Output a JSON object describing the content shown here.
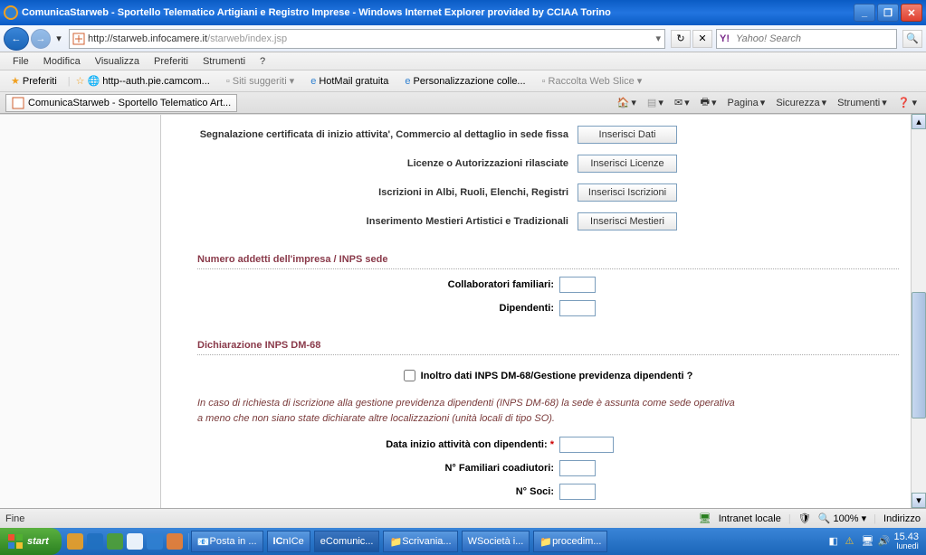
{
  "window": {
    "title": "ComunicaStarweb - Sportello Telematico Artigiani e Registro Imprese - Windows Internet Explorer provided by CCIAA Torino"
  },
  "address": {
    "host": "http://starweb.infocamere.it",
    "path": "/starweb/index.jsp"
  },
  "search": {
    "placeholder": "Yahoo! Search"
  },
  "menu": {
    "file": "File",
    "modifica": "Modifica",
    "visualizza": "Visualizza",
    "preferiti": "Preferiti",
    "strumenti": "Strumenti",
    "help": "?"
  },
  "favbar": {
    "preferiti": "Preferiti",
    "links": [
      "http--auth.pie.camcom...",
      "Siti suggeriti",
      "HotMail gratuita",
      "Personalizzazione colle...",
      "Raccolta Web Slice"
    ]
  },
  "tab": {
    "title": "ComunicaStarweb - Sportello Telematico Art..."
  },
  "cmdbar": {
    "pagina": "Pagina",
    "sicurezza": "Sicurezza",
    "strumenti": "Strumenti"
  },
  "form": {
    "rows": [
      {
        "label": "Segnalazione certificata di inizio attivita",
        "suffix": ", Commercio al dettaglio in sede fissa",
        "button": "Inserisci Dati"
      },
      {
        "label": "Licenze o Autorizzazioni rilasciate",
        "button": "Inserisci Licenze"
      },
      {
        "label": "Iscrizioni in Albi, Ruoli, Elenchi, Registri",
        "button": "Inserisci Iscrizioni"
      },
      {
        "label": "Inserimento Mestieri Artistici e Tradizionali",
        "button": "Inserisci Mestieri"
      }
    ],
    "section_addetti": "Numero addetti dell'impresa / INPS sede",
    "collab_label": "Collaboratori familiari:",
    "dipend_label": "Dipendenti:",
    "section_dm68": "Dichiarazione INPS DM-68",
    "checkbox_label": "Inoltro dati INPS DM-68/Gestione previdenza dipendenti ?",
    "note_line1": "In caso di richiesta di iscrizione alla gestione previdenza dipendenti (INPS DM-68) la sede è assunta come sede operativa",
    "note_line2": "a meno che non siano state dichiarate altre localizzazioni (unità locali di tipo SO).",
    "data_inizio_label": "Data inizio attività con dipendenti:",
    "n_familiari_label": "N° Familiari coadiutori:",
    "n_soci_label": "N° Soci:"
  },
  "status": {
    "left": "Fine",
    "zone": "Intranet locale",
    "zoom": "100%",
    "indirizzo": "Indirizzo"
  },
  "taskbar": {
    "start": "start",
    "items": [
      "Posta in ...",
      "nICe",
      "Comunic...",
      "Scrivania...",
      "Società i...",
      "procedim..."
    ],
    "ie_prefix": "IC"
  },
  "clock": {
    "time": "15.43",
    "day": "lunedì"
  }
}
